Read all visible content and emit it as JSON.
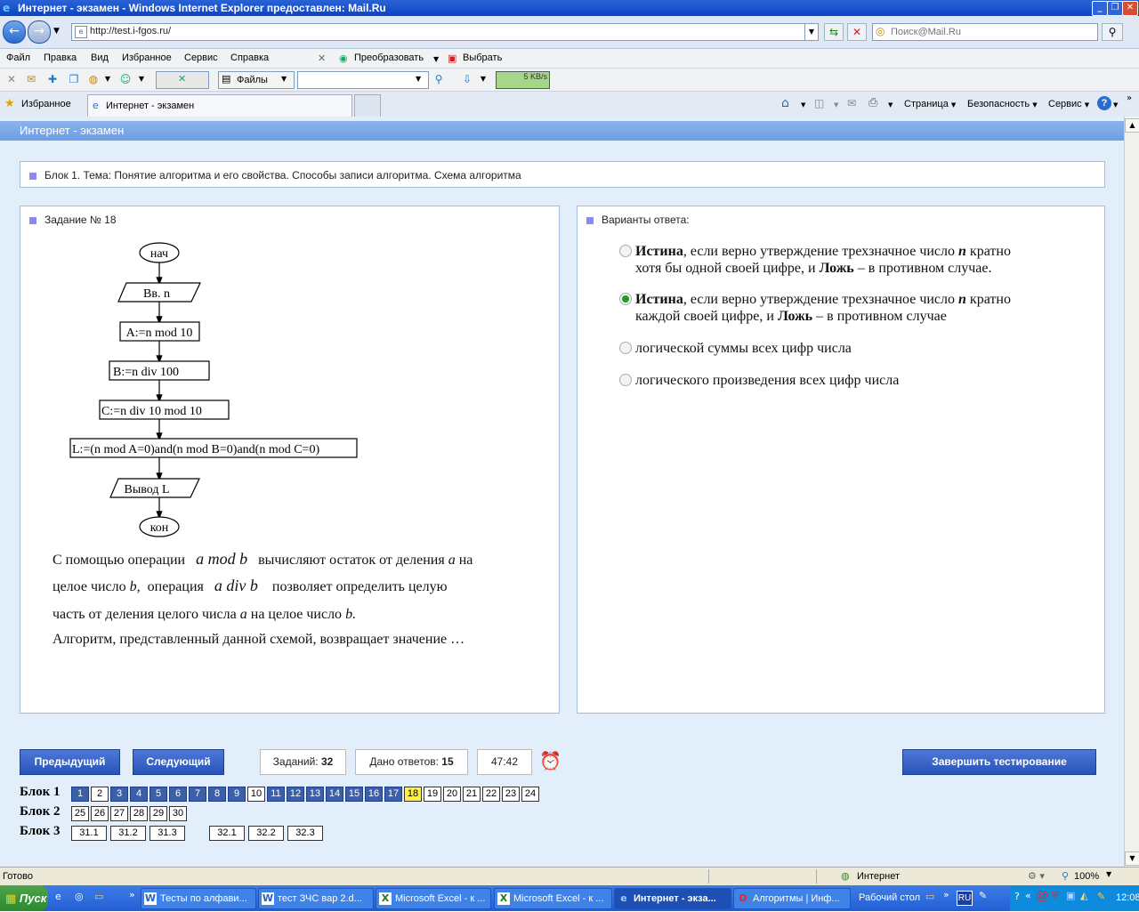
{
  "window": {
    "title": "Интернет - экзамен - Windows Internet Explorer предоставлен: Mail.Ru"
  },
  "address": {
    "url": "http://test.i-fgos.ru/"
  },
  "search": {
    "placeholder": "Поиск@Mail.Ru"
  },
  "menu": [
    "Файл",
    "Правка",
    "Вид",
    "Избранное",
    "Сервис",
    "Справка"
  ],
  "toolbar": {
    "convert": "Преобразовать",
    "select": "Выбрать",
    "files": "Файлы",
    "speed": "5 KB/s"
  },
  "tabs": {
    "favorites": "Избранное",
    "active_tab": "Интернет - экзамен"
  },
  "commands": {
    "page": "Страница",
    "security": "Безопасность",
    "tools": "Сервис"
  },
  "page": {
    "header": "Интернет - экзамен",
    "block_title": "Блок 1. Тема: Понятие алгоритма и его свойства. Способы записи алгоритма. Схема алгоритма",
    "task_title": "Задание № 18",
    "answers_title": "Варианты ответа:"
  },
  "flowchart": {
    "start": "нач",
    "input": "Вв. n",
    "a": "A:=n mod 10",
    "b": "B:=n div 100",
    "c": "C:=n div 10 mod 10",
    "l": "L:=(n mod A=0)and(n mod B=0)and(n mod C=0)",
    "output": "Вывод L",
    "end": "кон"
  },
  "task_text": {
    "l1a": "С помощью операции",
    "l1op": "a mod b",
    "l1b": "вычисляют остаток от деления",
    "l1v": "a",
    "l1c": "на",
    "l2a": "целое число",
    "l2v": "b,",
    "l2b": "операция",
    "l2op": "a div b",
    "l2c": "позволяет определить целую",
    "l3a": "часть от деления целого числа",
    "l3v": "a",
    "l3b": "на целое число",
    "l3v2": "b.",
    "l4": "Алгоритм, представленный данной схемой, возвращает значение …"
  },
  "answers": [
    {
      "b1": "Истина",
      "t1": ", если верно утверждение трехзначное число ",
      "v": "n",
      "t2": "  кратно",
      "line2a": "хотя бы одной своей цифре, и ",
      "b2": "Ложь",
      "line2b": " – в противном случае.",
      "selected": false
    },
    {
      "b1": "Истина",
      "t1": ", если верно утверждение трехзначное число ",
      "v": "n",
      "t2": " кратно",
      "line2a": "каждой своей цифре, и ",
      "b2": "Ложь",
      "line2b": " – в противном случае",
      "selected": true
    },
    {
      "text": "логической суммы всех цифр числа",
      "selected": false
    },
    {
      "text": "логического произведения всех цифр числа",
      "selected": false
    }
  ],
  "nav": {
    "prev": "Предыдущий",
    "next": "Следующий",
    "tasks_label": "Заданий:",
    "tasks_count": "32",
    "answered_label": "Дано ответов:",
    "answered_count": "15",
    "timer": "47:42",
    "finish": "Завершить тестирование"
  },
  "blocks": [
    {
      "label": "Блок 1",
      "items": [
        "1",
        "2",
        "3",
        "4",
        "5",
        "6",
        "7",
        "8",
        "9",
        "10",
        "11",
        "12",
        "13",
        "14",
        "15",
        "16",
        "17",
        "18",
        "19",
        "20",
        "21",
        "22",
        "23",
        "24"
      ]
    },
    {
      "label": "Блок 2",
      "items": [
        "25",
        "26",
        "27",
        "28",
        "29",
        "30"
      ]
    },
    {
      "label": "Блок 3",
      "items": [
        "31.1",
        "31.2",
        "31.3",
        "32.1",
        "32.2",
        "32.3"
      ]
    }
  ],
  "answered_items": [
    "1",
    "3",
    "4",
    "5",
    "6",
    "7",
    "8",
    "9",
    "11",
    "12",
    "13",
    "14",
    "15",
    "16",
    "17"
  ],
  "current_item": "18",
  "status": {
    "left": "Готово",
    "zone": "Интернет",
    "zoom": "100%"
  },
  "taskbar": {
    "start": "Пуск",
    "items": [
      "Тесты по алфави...",
      "тест ЗЧС вар 2.d...",
      "Microsoft Excel - к ...",
      "Microsoft Excel - к ...",
      "Интернет - экза...",
      "Алгоритмы | Инф..."
    ],
    "desktop": "Рабочий стол",
    "lang": "RU",
    "clock": "12:08"
  }
}
